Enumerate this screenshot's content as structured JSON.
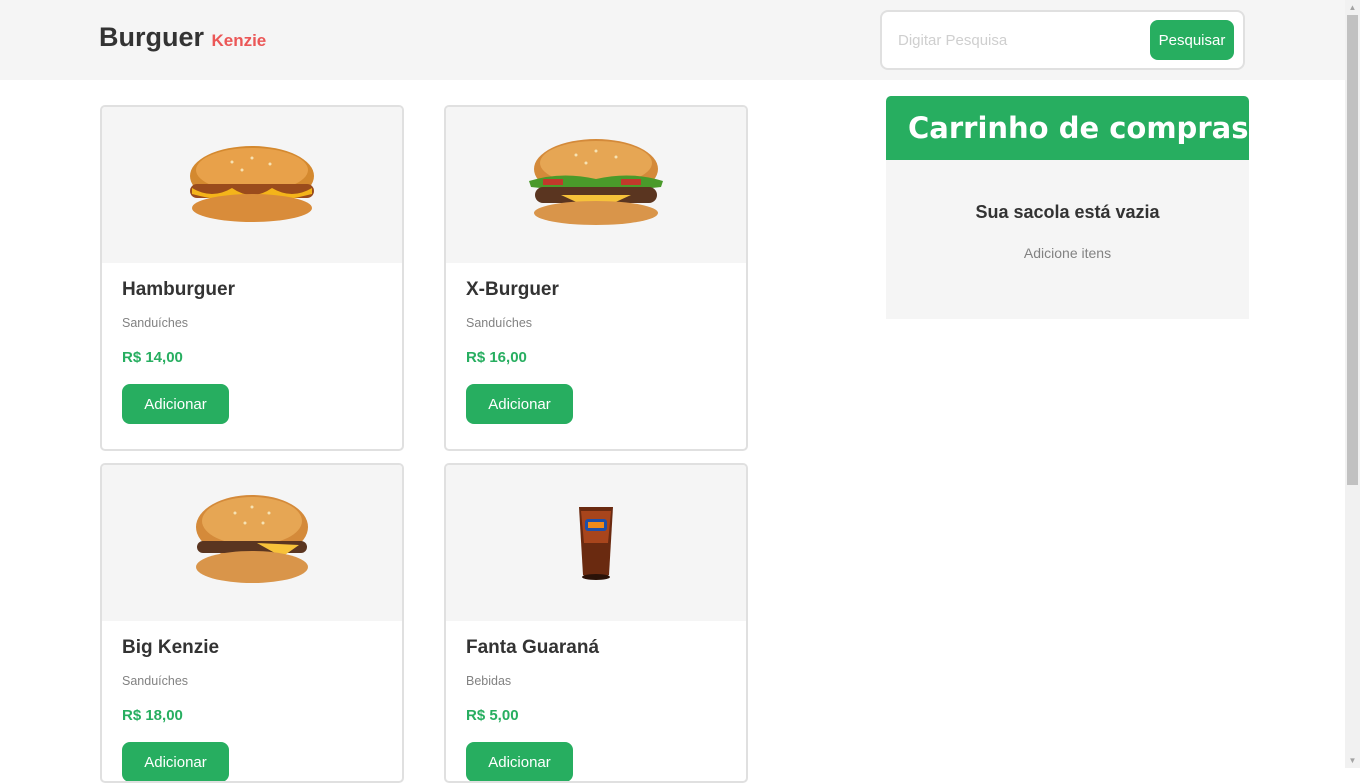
{
  "header": {
    "logo_main": "Burguer",
    "logo_sub": "Kenzie",
    "search_placeholder": "Digitar Pesquisa",
    "search_button": "Pesquisar"
  },
  "products": [
    {
      "name": "Hamburguer",
      "category": "Sanduíches",
      "price": "R$ 14,00",
      "button": "Adicionar",
      "image": "hamburger-image"
    },
    {
      "name": "X-Burguer",
      "category": "Sanduíches",
      "price": "R$ 16,00",
      "button": "Adicionar",
      "image": "cheeseburger-image"
    },
    {
      "name": "Big Kenzie",
      "category": "Sanduíches",
      "price": "R$ 18,00",
      "button": "Adicionar",
      "image": "burger-image"
    },
    {
      "name": "Fanta Guaraná",
      "category": "Bebidas",
      "price": "R$ 5,00",
      "button": "Adicionar",
      "image": "soda-cup-image"
    }
  ],
  "cart": {
    "title": "Carrinho de compras",
    "empty_message": "Sua sacola está vazia",
    "hint": "Adicione itens"
  },
  "colors": {
    "primary": "#27ae60",
    "accent": "#eb5757",
    "text": "#333333",
    "muted": "#828282",
    "panel": "#f5f5f5"
  }
}
